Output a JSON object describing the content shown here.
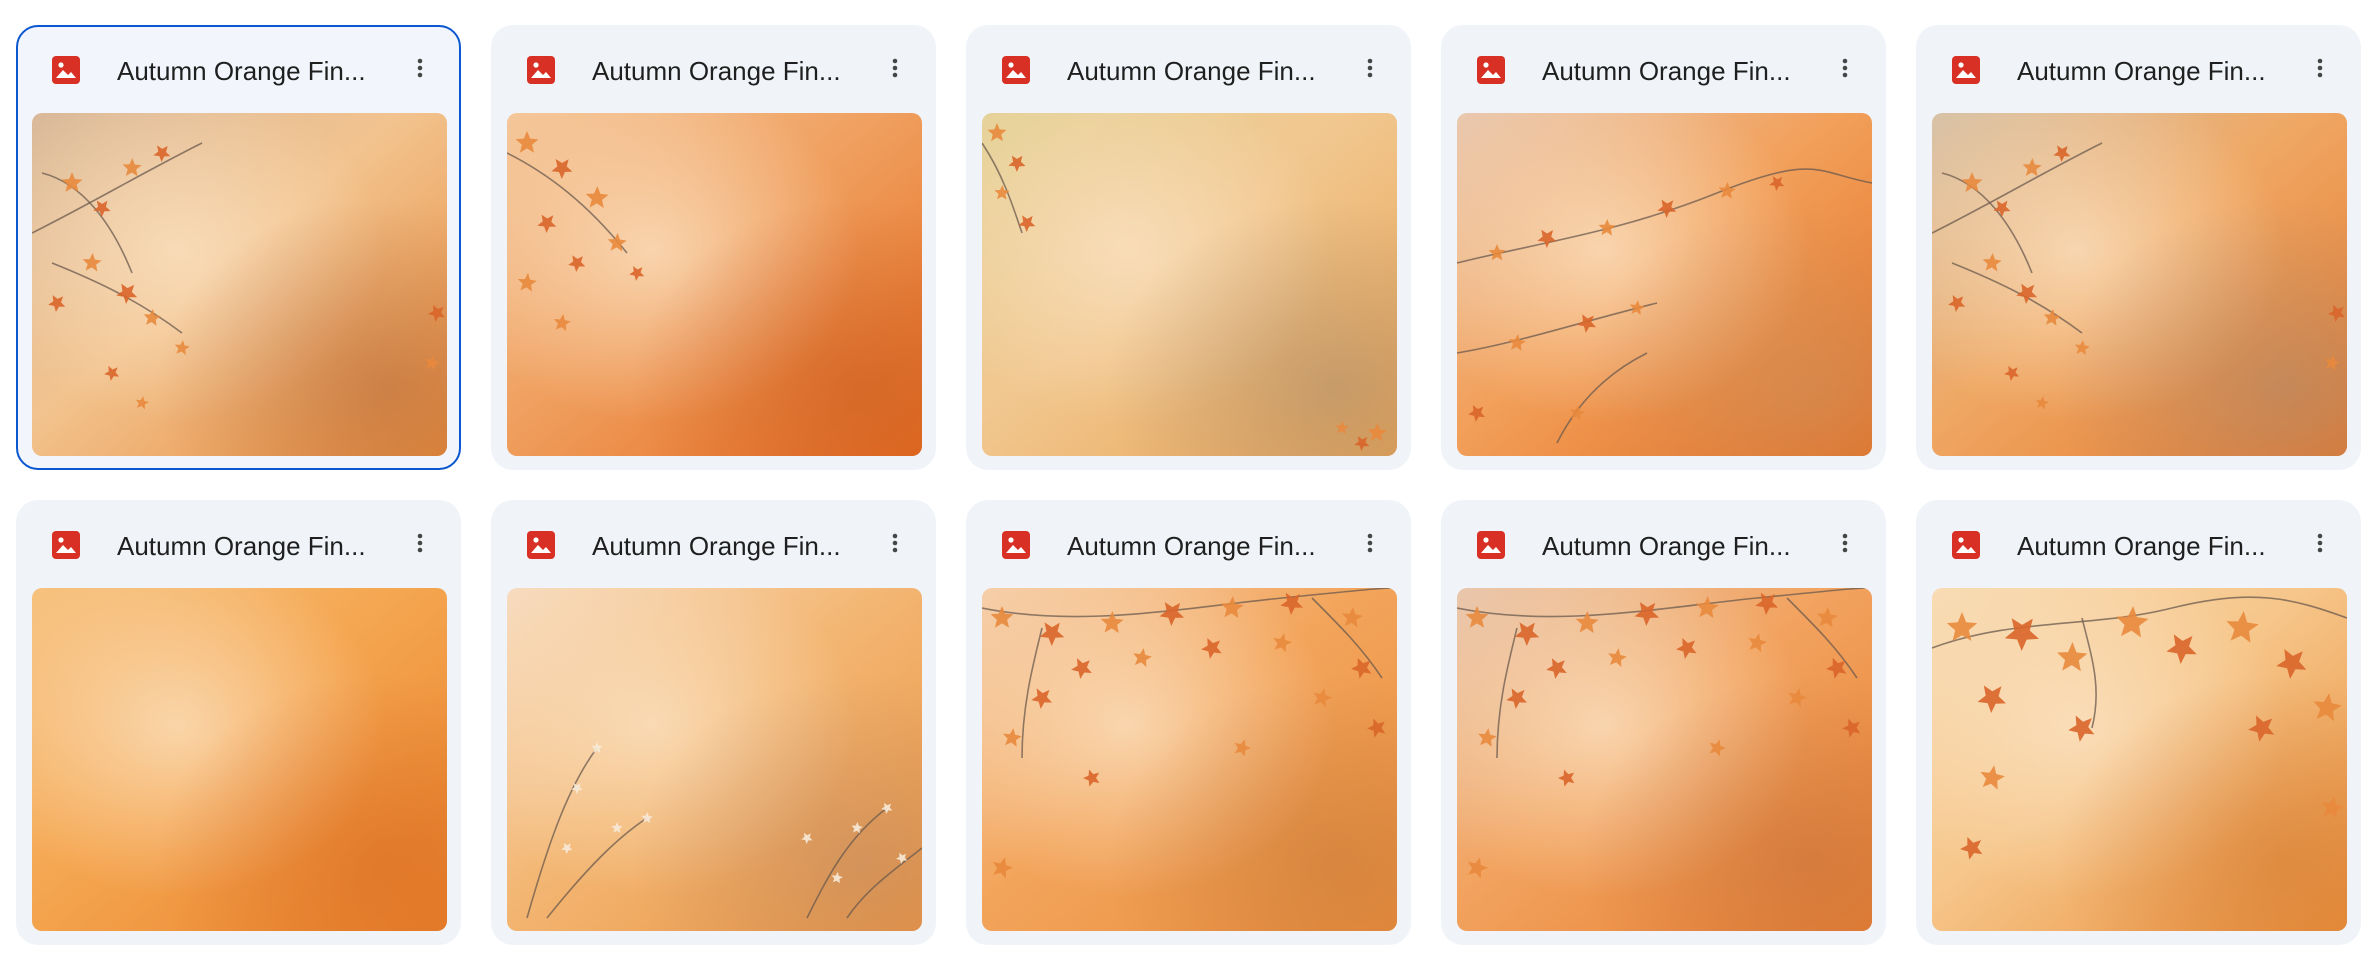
{
  "files": [
    {
      "name": "Autumn Orange Fin...",
      "icon": "image-file-icon",
      "selected": true,
      "palette": [
        "#f2c38e",
        "#e88a3a",
        "#d9b99a",
        "#b46a3a"
      ],
      "motif": "branch-left"
    },
    {
      "name": "Autumn Orange Fin...",
      "icon": "image-file-icon",
      "selected": false,
      "palette": [
        "#f0a060",
        "#e56b1f",
        "#f4c79a",
        "#c85a20"
      ],
      "motif": "leaves-left"
    },
    {
      "name": "Autumn Orange Fin...",
      "icon": "image-file-icon",
      "selected": false,
      "palette": [
        "#f1c78f",
        "#e9a453",
        "#e5d39a",
        "#a98a6b"
      ],
      "motif": "corner-leaves"
    },
    {
      "name": "Autumn Orange Fin...",
      "icon": "image-file-icon",
      "selected": false,
      "palette": [
        "#f2a15c",
        "#e56e22",
        "#e9c9b0",
        "#c9905e"
      ],
      "motif": "branch-wide"
    },
    {
      "name": "Autumn Orange Fin...",
      "icon": "image-file-icon",
      "selected": false,
      "palette": [
        "#efa864",
        "#e6772b",
        "#d8c3a8",
        "#a88a70"
      ],
      "motif": "branch-left"
    },
    {
      "name": "Autumn Orange Fin...",
      "icon": "image-file-icon",
      "selected": false,
      "palette": [
        "#f5a650",
        "#e8802c",
        "#f6c27f",
        "#d76a20"
      ],
      "motif": "plain"
    },
    {
      "name": "Autumn Orange Fin...",
      "icon": "image-file-icon",
      "selected": false,
      "palette": [
        "#f3b774",
        "#eb9340",
        "#f7dcc0",
        "#bf8a62"
      ],
      "motif": "flowers"
    },
    {
      "name": "Autumn Orange Fin...",
      "icon": "image-file-icon",
      "selected": false,
      "palette": [
        "#f3a55c",
        "#e98c3c",
        "#f5cfaa",
        "#c77a3a"
      ],
      "motif": "leaves-top"
    },
    {
      "name": "Autumn Orange Fin...",
      "icon": "image-file-icon",
      "selected": false,
      "palette": [
        "#f2a35f",
        "#e77f33",
        "#e9c7ad",
        "#c4703a"
      ],
      "motif": "leaves-top"
    },
    {
      "name": "Autumn Orange Fin...",
      "icon": "image-file-icon",
      "selected": false,
      "palette": [
        "#f6c68a",
        "#ea8e3b",
        "#f8dcb5",
        "#d27a30"
      ],
      "motif": "big-leaves"
    }
  ],
  "icons": {
    "file_type": "image-file-icon",
    "more_actions": "more-vert-icon"
  },
  "colors": {
    "file_icon_red": "#d93025",
    "selection_border": "#0b57d0",
    "card_background": "#f0f4f9"
  }
}
